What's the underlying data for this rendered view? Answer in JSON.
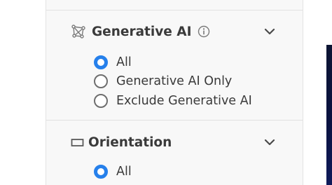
{
  "filters": {
    "generative_ai": {
      "title": "Generative AI",
      "options": [
        {
          "label": "All",
          "selected": true
        },
        {
          "label": "Generative AI Only",
          "selected": false
        },
        {
          "label": "Exclude Generative AI",
          "selected": false
        }
      ]
    },
    "orientation": {
      "title": "Orientation",
      "options": [
        {
          "label": "All",
          "selected": true
        }
      ]
    }
  },
  "icons": {
    "generative_ai": "generative-ai-icon",
    "info": "info-icon",
    "chevron": "chevron-down-icon",
    "orientation": "rectangle-icon"
  },
  "colors": {
    "accent": "#2680eb",
    "panel_bg": "#f8f8f8",
    "divider": "#e1e1e1",
    "text": "#3a3a3a"
  }
}
